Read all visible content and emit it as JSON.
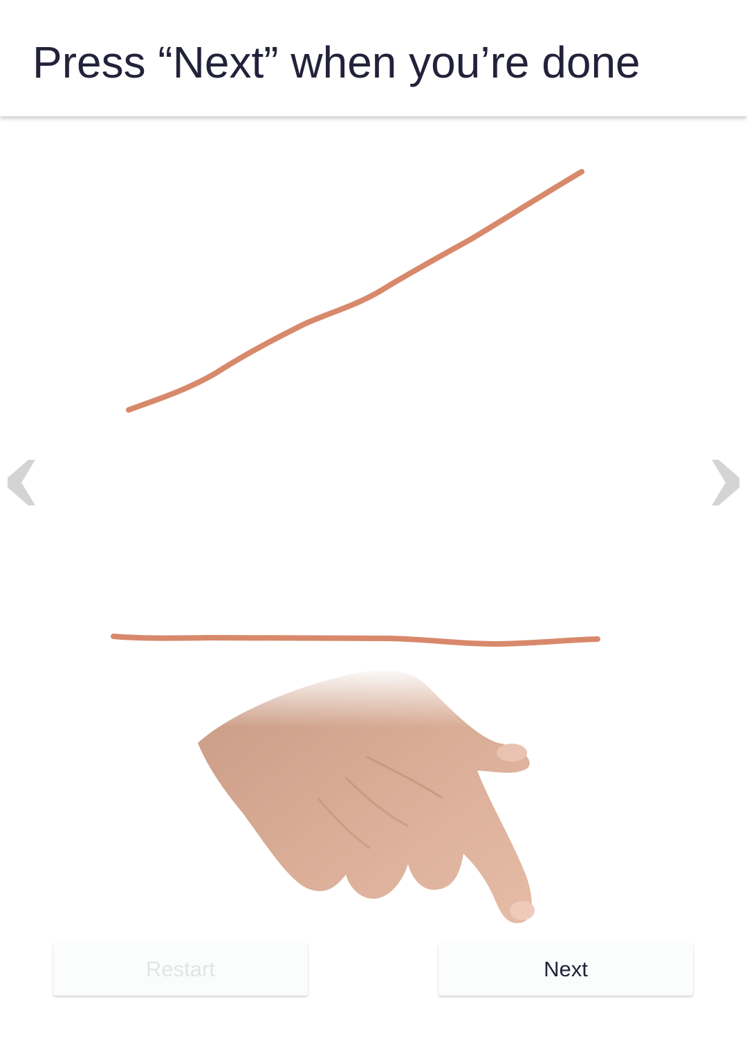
{
  "header": {
    "title": "Press “Next” when you’re done"
  },
  "drawing": {
    "stroke_color": "#d8896b",
    "strokes": [
      "diagonal-stroke",
      "horizontal-stroke"
    ]
  },
  "navigation": {
    "left_icon": "chevron-left-icon",
    "right_icon": "chevron-right-icon",
    "arrow_color": "#d4d4d4"
  },
  "illustration": {
    "icon": "pointing-hand-icon"
  },
  "buttons": {
    "restart_label": "Restart",
    "restart_enabled": false,
    "next_label": "Next",
    "next_enabled": true
  }
}
